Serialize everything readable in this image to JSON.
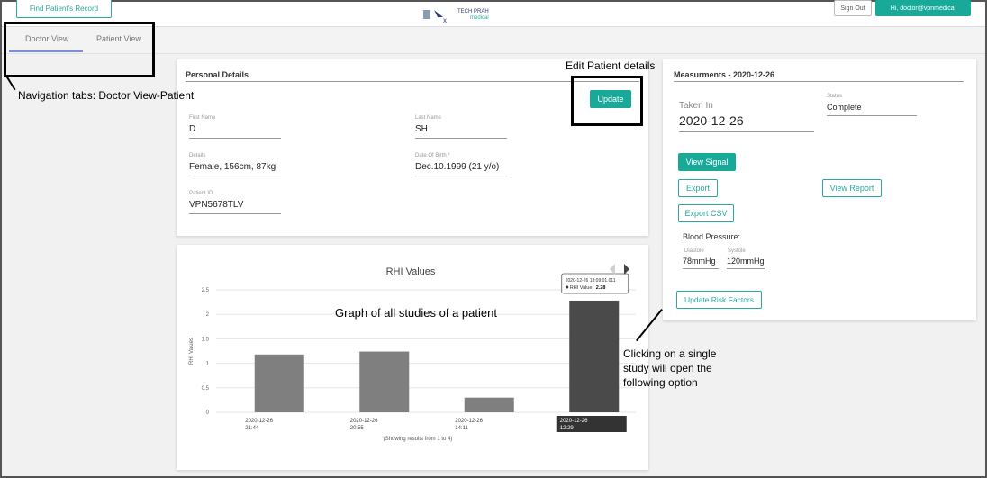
{
  "topbar": {
    "find_button_label": "Find Patient's Record",
    "logo_text_top": "TECH PRAH",
    "logo_text_bottom": "medical",
    "right_small_label": "Sign Out",
    "right_button_label": "Hi, doctor@vpnmedical"
  },
  "tabs": [
    {
      "label": "Doctor View",
      "active": true
    },
    {
      "label": "Patient View",
      "active": false
    }
  ],
  "personal_details": {
    "title": "Personal Details",
    "update_button": "Update",
    "fields": {
      "first_name": {
        "label": "First Name",
        "value": "D"
      },
      "last_name": {
        "label": "Last Name",
        "value": "SH"
      },
      "details": {
        "label": "Details",
        "value": "Female, 156cm, 87kg"
      },
      "dob": {
        "label": "Date Of Birth *",
        "value": "Dec.10.1999 (21 y/o)"
      },
      "patient_id": {
        "label": "Patient ID",
        "value": "VPN5678TLV"
      }
    }
  },
  "measurements": {
    "title": "Measurments - 2020-12-26",
    "taken_in_label": "Taken In",
    "taken_in_value": "2020-12-26",
    "status_label": "Status",
    "status_value": "Complete",
    "view_signal": "View Signal",
    "export": "Export",
    "view_report": "View Report",
    "export_csv": "Export CSV",
    "bp_label": "Blood Pressure:",
    "diastole_label": "Diastole",
    "diastole_value": "78mmHg",
    "systole_label": "Systole",
    "systole_value": "120mmHg",
    "update_risk": "Update Risk Factors"
  },
  "chart_data": {
    "type": "bar",
    "title": "RHI Values",
    "ylabel": "RHI Values",
    "xlabel": "",
    "ylim": [
      0,
      2.5
    ],
    "yticks": [
      0,
      0.5,
      1,
      1.5,
      2,
      2.5
    ],
    "categories": [
      "2020-12-26\n21:44",
      "2020-12-26\n20:55",
      "2020-12-26\n14:11",
      "2020-12-26\n12:29"
    ],
    "values": [
      1.18,
      1.24,
      0.3,
      2.28
    ],
    "selected_index": 3,
    "footer": "(Showing results from 1 to 4)",
    "tooltip": {
      "title": "2020-12-26 13:09:01.011",
      "label": "RHI Value:",
      "value": "2.28"
    },
    "colors": {
      "bar": "#7f7f7f",
      "selected_bar": "#4a4a4a",
      "grid": "#e6e6e6"
    }
  },
  "annotations": {
    "nav_tabs": "Navigation tabs: Doctor View-Patient",
    "edit_patient": "Edit Patient details",
    "graph": "Graph of all  studies of a patient",
    "click_study": [
      "Clicking on a single",
      "study will open the",
      "following option"
    ]
  }
}
